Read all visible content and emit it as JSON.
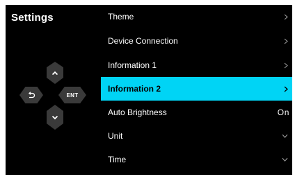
{
  "title": "Settings",
  "dpad": {
    "up_icon": "chevron-up-icon",
    "down_icon": "chevron-down-icon",
    "back_icon": "back-arrow-icon",
    "enter_label": "ENT"
  },
  "menu": {
    "items": [
      {
        "label": "Theme",
        "indicator": "chevron-right"
      },
      {
        "label": "Device Connection",
        "indicator": "chevron-right"
      },
      {
        "label": "Information 1",
        "indicator": "chevron-right"
      },
      {
        "label": "Information 2",
        "indicator": "chevron-right",
        "selected": true
      },
      {
        "label": "Auto Brightness",
        "value": "On"
      },
      {
        "label": "Unit",
        "indicator": "chevron-down"
      },
      {
        "label": "Time",
        "indicator": "chevron-down"
      }
    ]
  },
  "colors": {
    "background": "#000000",
    "highlight": "#00d4f5",
    "button": "#3a3a3a"
  }
}
